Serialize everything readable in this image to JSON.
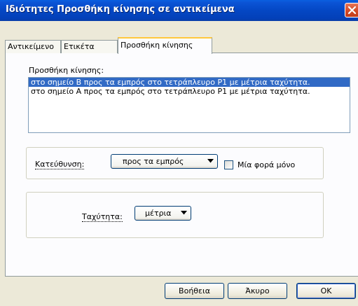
{
  "window": {
    "title": "Ιδιότητες Προσθήκη κίνησης σε αντικείμενα"
  },
  "tabs": [
    {
      "label": "Αντικείμενο"
    },
    {
      "label": "Ετικέτα"
    },
    {
      "label": "Προσθήκη κίνησης",
      "selected": true
    }
  ],
  "motion": {
    "list_label": "Προσθήκη κίνησης:",
    "items": [
      {
        "text": "στο σημείο B προς τα εμπρός στο τετράπλευρο P1 με μέτρια ταχύτητα.",
        "selected": true
      },
      {
        "text": "στο σημείο A προς τα εμπρός στο τετράπλευρο P1 με μέτρια ταχύτητα.",
        "selected": false
      }
    ]
  },
  "direction": {
    "label": "Κατεύθυνση:",
    "value": "προς τα εμπρός",
    "once_label": "Μία φορά μόνο",
    "once_checked": false
  },
  "speed": {
    "label": "Ταχύτητα:",
    "value": "μέτρια"
  },
  "buttons": {
    "help": "Βοήθεια",
    "cancel": "Άκυρο",
    "ok": "OK"
  },
  "colors": {
    "titlebar": "#0447c4",
    "selection": "#316ac5",
    "dialog_bg": "#ece9d8",
    "close_button": "#d44a26"
  },
  "icons": {
    "close": "close-icon",
    "dropdown": "chevron-down-icon"
  }
}
